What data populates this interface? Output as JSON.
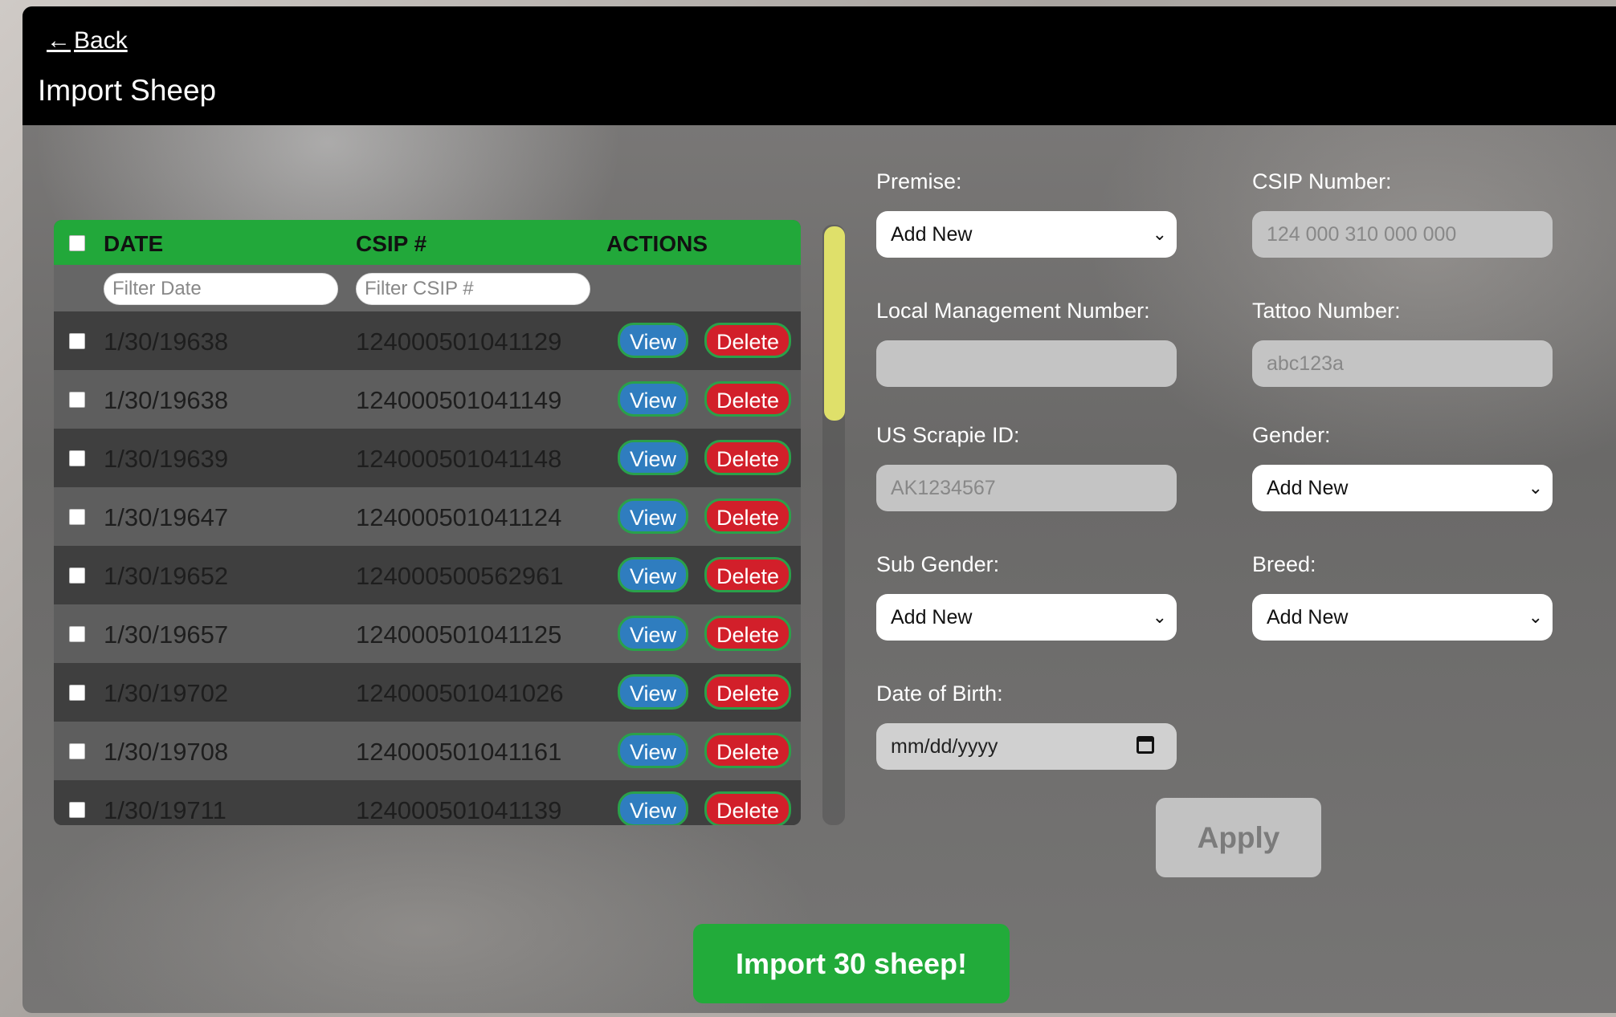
{
  "header": {
    "back_label": "Back",
    "back_arrow": "←",
    "title": "Import Sheep"
  },
  "table": {
    "columns": {
      "date": "DATE",
      "csip": "CSIP #",
      "actions": "ACTIONS"
    },
    "filters": {
      "date_placeholder": "Filter Date",
      "csip_placeholder": "Filter CSIP #"
    },
    "view_label": "View",
    "delete_label": "Delete",
    "rows": [
      {
        "date": "1/30/19638",
        "csip": "124000501041129"
      },
      {
        "date": "1/30/19638",
        "csip": "124000501041149"
      },
      {
        "date": "1/30/19639",
        "csip": "124000501041148"
      },
      {
        "date": "1/30/19647",
        "csip": "124000501041124"
      },
      {
        "date": "1/30/19652",
        "csip": "124000500562961"
      },
      {
        "date": "1/30/19657",
        "csip": "124000501041125"
      },
      {
        "date": "1/30/19702",
        "csip": "124000501041026"
      },
      {
        "date": "1/30/19708",
        "csip": "124000501041161"
      },
      {
        "date": "1/30/19711",
        "csip": "124000501041139"
      }
    ]
  },
  "form": {
    "premise": {
      "label": "Premise:",
      "value": "Add New"
    },
    "csip_number": {
      "label": "CSIP Number:",
      "placeholder": "124 000 310 000 000"
    },
    "local_mgmt": {
      "label": "Local Management Number:",
      "placeholder": ""
    },
    "tattoo": {
      "label": "Tattoo Number:",
      "placeholder": "abc123a"
    },
    "scrapie": {
      "label": "US Scrapie ID:",
      "placeholder": "AK1234567"
    },
    "gender": {
      "label": "Gender:",
      "value": "Add New"
    },
    "sub_gender": {
      "label": "Sub Gender:",
      "value": "Add New"
    },
    "breed": {
      "label": "Breed:",
      "value": "Add New"
    },
    "dob": {
      "label": "Date of Birth:",
      "value": "mm/dd/yyyy"
    },
    "apply_label": "Apply"
  },
  "import_label": "Import 30 sheep!",
  "colors": {
    "accent_green": "#22a83a",
    "view_blue": "#2f7dbf",
    "delete_red": "#d21f2a",
    "scroll_yellow": "#dfe06a"
  },
  "icons": {
    "select_chevron": "chevron-down-icon",
    "calendar": "calendar-icon",
    "back": "arrow-left-icon"
  }
}
